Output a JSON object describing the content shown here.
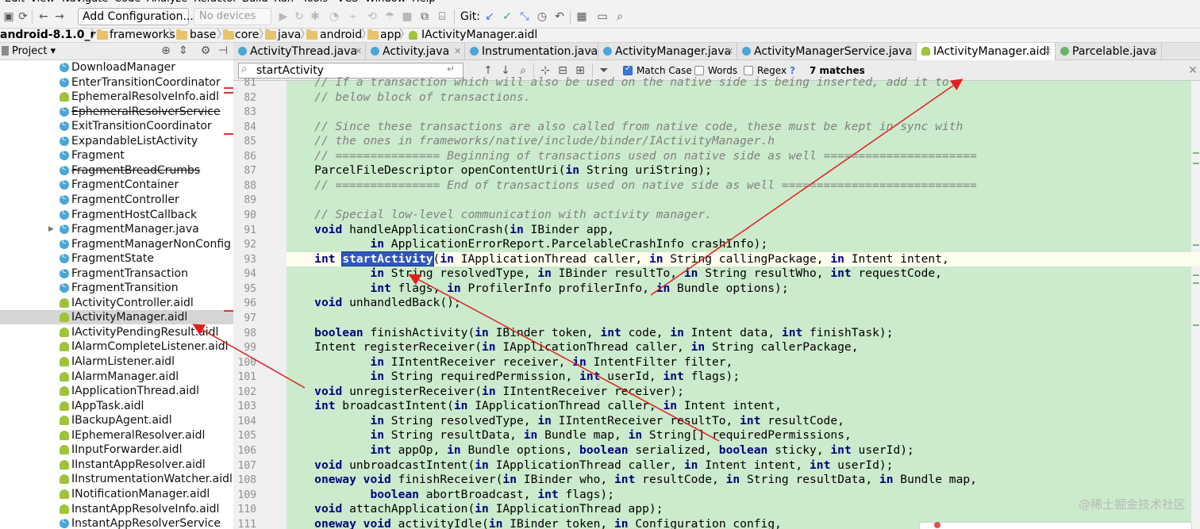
{
  "menu": [
    "Edit",
    "View",
    "Navigate",
    "Code",
    "Analyze",
    "Refactor",
    "Build",
    "Run",
    "Tools",
    "VCS",
    "Window",
    "Help"
  ],
  "toolbar": {
    "add_configuration": "Add Configuration...",
    "device": "No devices",
    "git_label": "Git:"
  },
  "breadcrumb": [
    "android-8.1.0_r1",
    "frameworks",
    "base",
    "core",
    "java",
    "android",
    "app",
    "IActivityManager.aidl"
  ],
  "project_panel": {
    "title": "Project",
    "items": [
      {
        "label": "DownloadManager",
        "icon": "class-icon",
        "strike": false,
        "selected": false
      },
      {
        "label": "EnterTransitionCoordinator",
        "icon": "class-icon",
        "strike": false,
        "selected": false
      },
      {
        "label": "EphemeralResolveInfo.aidl",
        "icon": "android-icon",
        "strike": false,
        "selected": false
      },
      {
        "label": "EphemeralResolverService",
        "icon": "class-icon",
        "strike": true,
        "selected": false
      },
      {
        "label": "ExitTransitionCoordinator",
        "icon": "class-icon",
        "strike": false,
        "selected": false
      },
      {
        "label": "ExpandableListActivity",
        "icon": "class-icon",
        "strike": false,
        "selected": false
      },
      {
        "label": "Fragment",
        "icon": "class-icon",
        "strike": false,
        "selected": false
      },
      {
        "label": "FragmentBreadCrumbs",
        "icon": "class-icon",
        "strike": true,
        "selected": false
      },
      {
        "label": "FragmentContainer",
        "icon": "class-icon",
        "strike": false,
        "selected": false
      },
      {
        "label": "FragmentController",
        "icon": "class-icon",
        "strike": false,
        "selected": false
      },
      {
        "label": "FragmentHostCallback",
        "icon": "class-icon",
        "strike": false,
        "selected": false
      },
      {
        "label": "FragmentManager.java",
        "icon": "class-icon",
        "strike": false,
        "selected": false
      },
      {
        "label": "FragmentManagerNonConfig",
        "icon": "class-icon",
        "strike": false,
        "selected": false
      },
      {
        "label": "FragmentState",
        "icon": "class-icon",
        "strike": false,
        "selected": false
      },
      {
        "label": "FragmentTransaction",
        "icon": "class-icon",
        "strike": false,
        "selected": false
      },
      {
        "label": "FragmentTransition",
        "icon": "class-icon",
        "strike": false,
        "selected": false
      },
      {
        "label": "IActivityController.aidl",
        "icon": "android-icon",
        "strike": false,
        "selected": false
      },
      {
        "label": "IActivityManager.aidl",
        "icon": "android-icon",
        "strike": false,
        "selected": true
      },
      {
        "label": "IActivityPendingResult.aidl",
        "icon": "android-icon",
        "strike": false,
        "selected": false
      },
      {
        "label": "IAlarmCompleteListener.aidl",
        "icon": "android-icon",
        "strike": false,
        "selected": false
      },
      {
        "label": "IAlarmListener.aidl",
        "icon": "android-icon",
        "strike": false,
        "selected": false
      },
      {
        "label": "IAlarmManager.aidl",
        "icon": "android-icon",
        "strike": false,
        "selected": false
      },
      {
        "label": "IApplicationThread.aidl",
        "icon": "android-icon",
        "strike": false,
        "selected": false
      },
      {
        "label": "IAppTask.aidl",
        "icon": "android-icon",
        "strike": false,
        "selected": false
      },
      {
        "label": "IBackupAgent.aidl",
        "icon": "android-icon",
        "strike": false,
        "selected": false
      },
      {
        "label": "IEphemeralResolver.aidl",
        "icon": "android-icon",
        "strike": false,
        "selected": false
      },
      {
        "label": "IInputForwarder.aidl",
        "icon": "android-icon",
        "strike": false,
        "selected": false
      },
      {
        "label": "IInstantAppResolver.aidl",
        "icon": "android-icon",
        "strike": false,
        "selected": false
      },
      {
        "label": "IInstrumentationWatcher.aidl",
        "icon": "android-icon",
        "strike": false,
        "selected": false
      },
      {
        "label": "INotificationManager.aidl",
        "icon": "android-icon",
        "strike": false,
        "selected": false
      },
      {
        "label": "InstantAppResolveInfo.aidl",
        "icon": "android-icon",
        "strike": false,
        "selected": false
      },
      {
        "label": "InstantAppResolverService",
        "icon": "class-icon",
        "strike": false,
        "selected": false
      }
    ]
  },
  "tabs": [
    {
      "label": "ActivityThread.java",
      "icon": "class-icon",
      "active": false
    },
    {
      "label": "Activity.java",
      "icon": "class-icon",
      "active": false
    },
    {
      "label": "Instrumentation.java",
      "icon": "class-icon",
      "active": false
    },
    {
      "label": "ActivityManager.java",
      "icon": "class-icon",
      "active": false
    },
    {
      "label": "ActivityManagerService.java",
      "icon": "class-icon",
      "active": false
    },
    {
      "label": "IActivityManager.aidl",
      "icon": "android-icon",
      "active": true
    },
    {
      "label": "Parcelable.java",
      "icon": "interface-icon",
      "active": false
    }
  ],
  "find_bar": {
    "query": "startActivity",
    "match_case_label": "Match Case",
    "match_case": true,
    "words_label": "Words",
    "words": false,
    "regex_label": "Regex",
    "regex": false,
    "help": "?",
    "result": "7 matches"
  },
  "code": {
    "highlight_line": 93,
    "lines": [
      {
        "n": "81",
        "segs": [
          [
            "    ",
            ""
          ],
          [
            "// If a transaction which will also be used on the native side is being inserted, add it to",
            "cm"
          ]
        ]
      },
      {
        "n": "82",
        "segs": [
          [
            "    ",
            ""
          ],
          [
            "// below block of transactions.",
            "cm"
          ]
        ]
      },
      {
        "n": "83",
        "segs": []
      },
      {
        "n": "84",
        "segs": [
          [
            "    ",
            ""
          ],
          [
            "// Since these transactions are also called from native code, these must be kept in sync with",
            "cm"
          ]
        ]
      },
      {
        "n": "85",
        "segs": [
          [
            "    ",
            ""
          ],
          [
            "// the ones in frameworks/native/include/binder/IActivityManager.h",
            "cm"
          ]
        ]
      },
      {
        "n": "86",
        "segs": [
          [
            "    ",
            ""
          ],
          [
            "// =============== Beginning of transactions used on native side as well ======================",
            "cm"
          ]
        ]
      },
      {
        "n": "87",
        "segs": [
          [
            "    ParcelFileDescriptor openContentUri(",
            ""
          ],
          [
            "in",
            "kw"
          ],
          [
            " String uriString);",
            ""
          ]
        ]
      },
      {
        "n": "88",
        "segs": [
          [
            "    ",
            ""
          ],
          [
            "// =============== End of transactions used on native side as well ============================",
            "cm"
          ]
        ]
      },
      {
        "n": "89",
        "segs": []
      },
      {
        "n": "90",
        "segs": [
          [
            "    ",
            ""
          ],
          [
            "// Special low-level communication with activity manager.",
            "cm"
          ]
        ]
      },
      {
        "n": "91",
        "segs": [
          [
            "    ",
            ""
          ],
          [
            "void",
            "kw"
          ],
          [
            " handleApplicationCrash(",
            ""
          ],
          [
            "in",
            "kw"
          ],
          [
            " IBinder app,",
            ""
          ]
        ]
      },
      {
        "n": "92",
        "segs": [
          [
            "            ",
            ""
          ],
          [
            "in",
            "kw"
          ],
          [
            " ApplicationErrorReport.ParcelableCrashInfo crashInfo);",
            ""
          ]
        ]
      },
      {
        "n": "93",
        "segs": [
          [
            "    ",
            ""
          ],
          [
            "int",
            "kw"
          ],
          [
            " ",
            ""
          ],
          [
            "startActivity",
            "match"
          ],
          [
            "(",
            ""
          ],
          [
            "in",
            "kw"
          ],
          [
            " IApplicationThread caller, ",
            ""
          ],
          [
            "in",
            "kw"
          ],
          [
            " String callingPackage, ",
            ""
          ],
          [
            "in",
            "kw"
          ],
          [
            " Intent intent,",
            ""
          ]
        ]
      },
      {
        "n": "94",
        "segs": [
          [
            "            ",
            ""
          ],
          [
            "in",
            "kw"
          ],
          [
            " String resolvedType, ",
            ""
          ],
          [
            "in",
            "kw"
          ],
          [
            " IBinder resultTo, ",
            ""
          ],
          [
            "in",
            "kw"
          ],
          [
            " String resultWho, ",
            ""
          ],
          [
            "int",
            "kw"
          ],
          [
            " requestCode,",
            ""
          ]
        ]
      },
      {
        "n": "95",
        "segs": [
          [
            "            ",
            ""
          ],
          [
            "int",
            "kw"
          ],
          [
            " flags, ",
            ""
          ],
          [
            "in",
            "kw"
          ],
          [
            " ProfilerInfo profilerInfo, ",
            ""
          ],
          [
            "in",
            "kw"
          ],
          [
            " Bundle options);",
            ""
          ]
        ]
      },
      {
        "n": "96",
        "segs": [
          [
            "    ",
            ""
          ],
          [
            "void",
            "kw"
          ],
          [
            " unhandledBack();",
            ""
          ]
        ]
      },
      {
        "n": "97",
        "segs": []
      },
      {
        "n": "98",
        "segs": [
          [
            "    ",
            ""
          ],
          [
            "boolean",
            "kw"
          ],
          [
            " finishActivity(",
            ""
          ],
          [
            "in",
            "kw"
          ],
          [
            " IBinder token, ",
            ""
          ],
          [
            "int",
            "kw"
          ],
          [
            " code, ",
            ""
          ],
          [
            "in",
            "kw"
          ],
          [
            " Intent data, ",
            ""
          ],
          [
            "int",
            "kw"
          ],
          [
            " finishTask);",
            ""
          ]
        ]
      },
      {
        "n": "99",
        "segs": [
          [
            "    Intent registerReceiver(",
            ""
          ],
          [
            "in",
            "kw"
          ],
          [
            " IApplicationThread caller, ",
            ""
          ],
          [
            "in",
            "kw"
          ],
          [
            " String callerPackage,",
            ""
          ]
        ]
      },
      {
        "n": "100",
        "segs": [
          [
            "            ",
            ""
          ],
          [
            "in",
            "kw"
          ],
          [
            " IIntentReceiver receiver, ",
            ""
          ],
          [
            "in",
            "kw"
          ],
          [
            " IntentFilter filter,",
            ""
          ]
        ]
      },
      {
        "n": "101",
        "segs": [
          [
            "            ",
            ""
          ],
          [
            "in",
            "kw"
          ],
          [
            " String requiredPermission, ",
            ""
          ],
          [
            "int",
            "kw"
          ],
          [
            " userId, ",
            ""
          ],
          [
            "int",
            "kw"
          ],
          [
            " flags);",
            ""
          ]
        ]
      },
      {
        "n": "102",
        "segs": [
          [
            "    ",
            ""
          ],
          [
            "void",
            "kw"
          ],
          [
            " unregisterReceiver(",
            ""
          ],
          [
            "in",
            "kw"
          ],
          [
            " IIntentReceiver receiver);",
            ""
          ]
        ]
      },
      {
        "n": "103",
        "segs": [
          [
            "    ",
            ""
          ],
          [
            "int",
            "kw"
          ],
          [
            " broadcastIntent(",
            ""
          ],
          [
            "in",
            "kw"
          ],
          [
            " IApplicationThread caller, ",
            ""
          ],
          [
            "in",
            "kw"
          ],
          [
            " Intent intent,",
            ""
          ]
        ]
      },
      {
        "n": "104",
        "segs": [
          [
            "            ",
            ""
          ],
          [
            "in",
            "kw"
          ],
          [
            " String resolvedType, ",
            ""
          ],
          [
            "in",
            "kw"
          ],
          [
            " IIntentReceiver resultTo, ",
            ""
          ],
          [
            "int",
            "kw"
          ],
          [
            " resultCode,",
            ""
          ]
        ]
      },
      {
        "n": "105",
        "segs": [
          [
            "            ",
            ""
          ],
          [
            "in",
            "kw"
          ],
          [
            " String resultData, ",
            ""
          ],
          [
            "in",
            "kw"
          ],
          [
            " Bundle map, ",
            ""
          ],
          [
            "in",
            "kw"
          ],
          [
            " String[] requiredPermissions,",
            ""
          ]
        ]
      },
      {
        "n": "106",
        "segs": [
          [
            "            ",
            ""
          ],
          [
            "int",
            "kw"
          ],
          [
            " appOp, ",
            ""
          ],
          [
            "in",
            "kw"
          ],
          [
            " Bundle options, ",
            ""
          ],
          [
            "boolean",
            "kw"
          ],
          [
            " serialized, ",
            ""
          ],
          [
            "boolean",
            "kw"
          ],
          [
            " sticky, ",
            ""
          ],
          [
            "int",
            "kw"
          ],
          [
            " userId);",
            ""
          ]
        ]
      },
      {
        "n": "107",
        "segs": [
          [
            "    ",
            ""
          ],
          [
            "void",
            "kw"
          ],
          [
            " unbroadcastIntent(",
            ""
          ],
          [
            "in",
            "kw"
          ],
          [
            " IApplicationThread caller, ",
            ""
          ],
          [
            "in",
            "kw"
          ],
          [
            " Intent intent, ",
            ""
          ],
          [
            "int",
            "kw"
          ],
          [
            " userId);",
            ""
          ]
        ]
      },
      {
        "n": "108",
        "segs": [
          [
            "    ",
            ""
          ],
          [
            "oneway",
            "kw"
          ],
          [
            " ",
            ""
          ],
          [
            "void",
            "kw"
          ],
          [
            " finishReceiver(",
            ""
          ],
          [
            "in",
            "kw"
          ],
          [
            " IBinder who, ",
            ""
          ],
          [
            "int",
            "kw"
          ],
          [
            " resultCode, ",
            ""
          ],
          [
            "in",
            "kw"
          ],
          [
            " String resultData, ",
            ""
          ],
          [
            "in",
            "kw"
          ],
          [
            " Bundle map,",
            ""
          ]
        ]
      },
      {
        "n": "109",
        "segs": [
          [
            "            ",
            ""
          ],
          [
            "boolean",
            "kw"
          ],
          [
            " abortBroadcast, ",
            ""
          ],
          [
            "int",
            "kw"
          ],
          [
            " flags);",
            ""
          ]
        ]
      },
      {
        "n": "110",
        "segs": [
          [
            "    ",
            ""
          ],
          [
            "void",
            "kw"
          ],
          [
            " attachApplication(",
            ""
          ],
          [
            "in",
            "kw"
          ],
          [
            " IApplicationThread app);",
            ""
          ]
        ]
      },
      {
        "n": "111",
        "segs": [
          [
            "    ",
            ""
          ],
          [
            "oneway",
            "kw"
          ],
          [
            " ",
            ""
          ],
          [
            "void",
            "kw"
          ],
          [
            " activityIdle(",
            ""
          ],
          [
            "in",
            "kw"
          ],
          [
            " IBinder token, ",
            ""
          ],
          [
            "in",
            "kw"
          ],
          [
            " Configuration config,",
            ""
          ]
        ]
      }
    ]
  },
  "annotation_color": "#e02020",
  "watermark": "@稀土掘金技术社区"
}
